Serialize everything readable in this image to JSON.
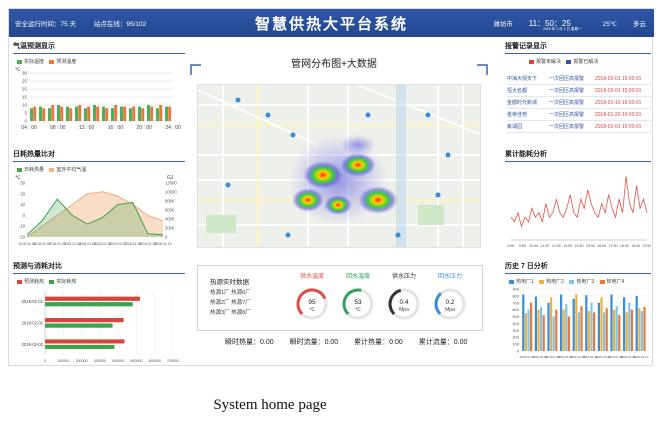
{
  "header": {
    "runtime_label": "安全运行时间：75 天",
    "stations_label": "站点在线：95/102",
    "title": "智慧供热大平台系统",
    "city": "潍坊市",
    "time": "11：50：25",
    "date": "2018 年 1 月 1 日 星期一",
    "temperature": "25℃",
    "weather": "多云"
  },
  "temp_forecast": {
    "title": "气温预测显示",
    "legend": [
      "实际温度",
      "预测温度"
    ],
    "colors": [
      "#4fae5a",
      "#e9793b"
    ],
    "chart_data": {
      "type": "bar",
      "ylabel": "℃",
      "yticks": [
        "30",
        "25",
        "20",
        "15",
        "10",
        "5",
        "0"
      ],
      "ylim": [
        0,
        30
      ],
      "categories": [
        "04 : 00",
        "08 : 00",
        "12 : 00",
        "16 : 00",
        "20 : 00",
        "24 : 00"
      ],
      "series": [
        {
          "name": "实际温度",
          "values": [
            8,
            9,
            8,
            10,
            9,
            9,
            8,
            10,
            9,
            8,
            9,
            8,
            9,
            10,
            8,
            9
          ]
        },
        {
          "name": "预测温度",
          "values": [
            9,
            8,
            10,
            9,
            8,
            10,
            9,
            9,
            8,
            10,
            9,
            9,
            8,
            9,
            10,
            9
          ]
        }
      ]
    }
  },
  "daily_heat": {
    "title": "日耗热量比对",
    "legend": [
      "日耗热量",
      "室外平均气温"
    ],
    "colors": [
      "#3fa34d",
      "#f3b183"
    ],
    "chart_data": {
      "type": "area",
      "yleft_label": "℃",
      "yleft_ticks": [
        "30",
        "20",
        "10",
        "0",
        "-10",
        "-20"
      ],
      "yright_label": "GJ",
      "yright_ticks": [
        "12000",
        "10000",
        "8000",
        "6000",
        "4000",
        "2000",
        "0"
      ],
      "categories": [
        "2018-01-01",
        "2018-01-02",
        "2018-01-03",
        "2018-01-04",
        "2018-01-05",
        "2018-01-06",
        "2018-01-07",
        "2018-01-08",
        "2018-01-09",
        "2018-01-10"
      ],
      "series": [
        {
          "name": "日耗热量",
          "values": [
            -18,
            -5,
            15,
            0,
            -8,
            -2,
            10,
            12,
            -17,
            -18
          ]
        },
        {
          "name": "室外平均气温",
          "values": [
            -20,
            -10,
            0,
            10,
            20,
            22,
            18,
            10,
            0,
            -5
          ]
        }
      ]
    }
  },
  "forecast_compare": {
    "title": "预测与消耗对比",
    "legend": [
      "预测耗热",
      "实际耗热"
    ],
    "colors": [
      "#d9453d",
      "#3fa34d"
    ],
    "chart_data": {
      "type": "bar",
      "orientation": "horizontal",
      "categories": [
        "2018-01-01",
        "2018-02-01",
        "2018-02-02"
      ],
      "xticks": [
        "0",
        "100000",
        "200000",
        "300000",
        "400000",
        "500000",
        "600000",
        "700000"
      ],
      "xlim": [
        0,
        700000
      ],
      "series": [
        {
          "name": "预测耗热",
          "values": [
            520000,
            430000,
            435000
          ]
        },
        {
          "name": "实际耗热",
          "values": [
            480000,
            370000,
            380000
          ]
        }
      ]
    }
  },
  "map": {
    "title": "管网分布图+大数据"
  },
  "realtime": {
    "title": "热源实时数据",
    "rows": [
      "热源1厂  热源6厂",
      "热源2厂  热源7厂",
      "热源3厂  热源8厂"
    ],
    "gauges": [
      {
        "label": "供水温度",
        "value": "95",
        "unit": "℃",
        "color": "#e0504a",
        "level": 0.75
      },
      {
        "label": "回水温度",
        "value": "53",
        "unit": "℃",
        "color": "#2fa35a",
        "level": 0.55
      },
      {
        "label": "供水压力",
        "value": "0.4",
        "unit": "Mpa",
        "color": "#333333",
        "level": 0.45
      },
      {
        "label": "回水压力",
        "value": "0.2",
        "unit": "Mpa",
        "color": "#3a8ed8",
        "level": 0.35
      }
    ]
  },
  "stats": [
    "瞬时热量：0.00",
    "瞬时流量：0.00",
    "累计热量：0.00",
    "累计流量：0.00"
  ],
  "alarm": {
    "title": "报警记录显示",
    "legend": [
      "报警未解决",
      "报警已解决"
    ],
    "colors": [
      "#d9453d",
      "#3455a4"
    ],
    "rows": [
      {
        "name": "中海大观天下",
        "type": "一次回压高报警",
        "time": "2018-02-01 15:00:01"
      },
      {
        "name": "恒大名都",
        "type": "一次回压高报警",
        "time": "2018-02-01 15:00:01"
      },
      {
        "name": "金都时代新城",
        "type": "一次回压高报警",
        "time": "2018-01-10 16:00:01"
      },
      {
        "name": "金帝佳苑",
        "type": "一次回压高报警",
        "time": "2018-01-20 19:00:01"
      },
      {
        "name": "紫湖园",
        "type": "一次回压高报警",
        "time": "2018-02-01 15:00:01"
      }
    ]
  },
  "cumulative": {
    "title": "累计能耗分析",
    "color": "#e0504a",
    "chart_data": {
      "type": "line",
      "categories": [
        "8:50",
        "9:50",
        "10:50",
        "11:50",
        "12:50",
        "13:50",
        "14:50",
        "15:50",
        "16:50",
        "17:50",
        "18:50",
        "19:50",
        "20:50"
      ],
      "values": [
        5,
        4,
        6,
        3,
        5,
        4,
        7,
        5,
        6,
        4,
        8,
        5,
        6,
        9,
        6,
        5,
        7,
        10,
        6,
        5,
        9,
        7,
        11,
        8,
        6,
        5,
        8,
        6,
        10,
        7,
        5,
        9,
        6,
        14,
        8,
        6,
        12,
        7,
        9,
        6
      ]
    }
  },
  "history": {
    "title": "历史 7 日分析",
    "legend": [
      "热电厂1",
      "热电厂2",
      "热电厂3",
      "热电厂4"
    ],
    "colors": [
      "#3a8ed8",
      "#f0b03c",
      "#7fc6e8",
      "#e9793b"
    ],
    "chart_data": {
      "type": "bar",
      "categories": [
        "2018-01-01",
        "2018-01-02",
        "2018-01-03",
        "2018-01-04",
        "2018-01-05",
        "2018-01-06",
        "2018-01-07",
        "2018-01-08",
        "2018-01-09",
        "2018-01-10"
      ],
      "yticks": [
        "900",
        "800",
        "700",
        "600",
        "500",
        "400",
        "300",
        "200",
        "100",
        "0"
      ],
      "ylim": [
        0,
        900
      ],
      "series": [
        {
          "name": "热电厂1",
          "values": [
            820,
            790,
            700,
            820,
            760,
            810,
            700,
            820,
            780,
            800
          ]
        },
        {
          "name": "热电厂2",
          "values": [
            550,
            600,
            780,
            600,
            820,
            580,
            780,
            600,
            560,
            620
          ]
        },
        {
          "name": "热电厂3",
          "values": [
            600,
            640,
            500,
            680,
            560,
            700,
            560,
            650,
            700,
            580
          ]
        },
        {
          "name": "热电厂4",
          "values": [
            700,
            520,
            600,
            500,
            650,
            560,
            620,
            520,
            600,
            640
          ]
        }
      ]
    }
  },
  "caption": "System home page"
}
